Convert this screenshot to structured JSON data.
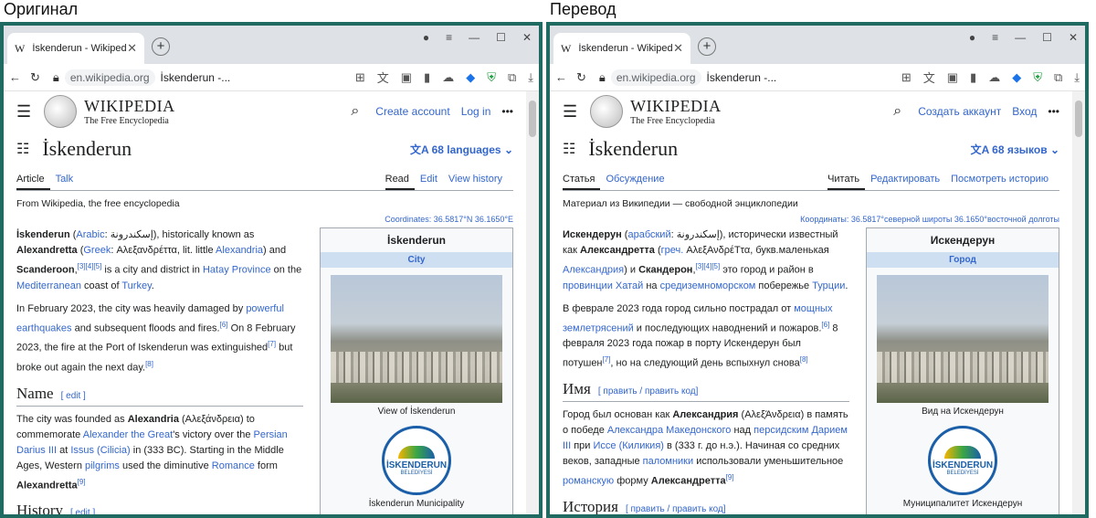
{
  "captions": {
    "left": "Оригинал",
    "right": "Перевод"
  },
  "left": {
    "tab_title": "İskenderun - Wikipedia",
    "favicon": "W",
    "url_domain": "en.wikipedia.org",
    "url_rest": "İskenderun -...",
    "wm_title": "WIKIPEDIA",
    "wm_tag": "The Free Encyclopedia",
    "create_account": "Create account",
    "log_in": "Log in",
    "page_title": "İskenderun",
    "languages": "68 languages",
    "tab_article": "Article",
    "tab_talk": "Talk",
    "tab_read": "Read",
    "tab_edit": "Edit",
    "tab_history": "View history",
    "from": "From Wikipedia, the free encyclopedia",
    "coords": "Coordinates: 36.5817°N 36.1650°E",
    "p1": {
      "a": "İskenderun",
      "b": " (",
      "c": "Arabic",
      "d": ": إسكندرونة), historically known as ",
      "e": "Alexandretta",
      "f": " (",
      "g": "Greek",
      "h": ": Αλεξανδρέττα, lit. little ",
      "i": "Alexandria",
      "j": ") and ",
      "k": "Scanderoon",
      "l": ",",
      "m": "[3][4][5]",
      "n": " is a city and district in ",
      "o": "Hatay Province",
      "p": " on the ",
      "q": "Mediterranean",
      "r": " coast of ",
      "s": "Turkey",
      "t": "."
    },
    "p2": {
      "a": "In February 2023, the city was heavily damaged by ",
      "b": "powerful earthquakes",
      "c": " and subsequent floods and fires.",
      "d": "[6]",
      "e": " On 8 February 2023, the fire at the Port of Iskenderun was extinguished",
      "f": "[7]",
      "g": " but broke out again the next day.",
      "h": "[8]"
    },
    "h_name": "Name",
    "edit": "[ edit ]",
    "p3": {
      "a": "The city was founded as ",
      "b": "Alexandria",
      "c": " (Αλεξάνδρεια) to commemorate ",
      "d": "Alexander the Great",
      "e": "'s victory over the ",
      "f": "Persian Darius III",
      "g": " at ",
      "h": "Issus (Cilicia)",
      "i": " in (333 BC). Starting in the Middle Ages, Western ",
      "j": "pilgrims",
      "k": " used the diminutive ",
      "l": "Romance",
      "m": " form ",
      "n": "Alexandretta",
      "o": "[9]"
    },
    "h_history": "History",
    "ib_title": "İskenderun",
    "ib_sub": "City",
    "ib_cap1": "View of İskenderun",
    "ib_cap2": "İskenderun Municipality",
    "logo_word": "İSKENDERUN",
    "logo_sub": "BELEDİYESİ"
  },
  "right": {
    "tab_title": "İskenderun - Wikipedia",
    "favicon": "W",
    "url_domain": "en.wikipedia.org",
    "url_rest": "İskenderun -...",
    "wm_title": "WIKIPEDIA",
    "wm_tag": "The Free Encyclopedia",
    "create_account": "Создать аккаунт",
    "log_in": "Вход",
    "page_title": "İskenderun",
    "languages": "68 языков",
    "tab_article": "Статья",
    "tab_talk": "Обсуждение",
    "tab_read": "Читать",
    "tab_edit": "Редактировать",
    "tab_history": "Посмотреть историю",
    "from": "Материал из Википедии — свободной энциклопедии",
    "coords": "Координаты: 36.5817°северной широты 36.1650°восточной долготы",
    "p1": {
      "a": "Искендерун",
      "b": " (",
      "c": "арабский",
      "d": ": إسكندرونة), исторически известный как ",
      "e": "Александретта",
      "f": " (",
      "g": "греч.",
      "h": " ΑλεξΑνδρέΤτα, букв.маленькая ",
      "i": "Александрия",
      "j": ") и ",
      "k": "Скандерон",
      "l": ",",
      "m": "[3][4][5]",
      "n": " это город и район в ",
      "o": "провинции Хатай",
      "p": " на ",
      "q": "средиземноморском",
      "r": " побережье ",
      "s": "Турции",
      "t": "."
    },
    "p2": {
      "a": "В феврале 2023 года город сильно пострадал от ",
      "b": "мощных землетрясений",
      "c": " и последующих наводнений и пожаров.",
      "d": "[6]",
      "e": " 8 февраля 2023 года пожар в порту Искендерун был потушен",
      "f": "[7]",
      "g": ", но на следующий день вспыхнул снова",
      "h": "[8]"
    },
    "h_name": "Имя",
    "edit": "[ править / править код]",
    "p3": {
      "a": "Город был основан как ",
      "b": "Александрия",
      "c": " (ΑλεξΆνδρεια) в память о победе ",
      "d": "Александра Македонского",
      "e": " над ",
      "f": "персидским Дарием III",
      "g": " при ",
      "h": "Иссе (Киликия)",
      "i": " в (333 г. до н.э.). Начиная со средних веков, западные ",
      "j": "паломники",
      "k": " использовали уменьшительное ",
      "l": "романскую",
      "m": " форму ",
      "n": "Александретта",
      "o": "[9]"
    },
    "h_history": "История",
    "ib_title": "Искендерун",
    "ib_sub": "Город",
    "ib_cap1": "Вид на Искендерун",
    "ib_cap2": "Муниципалитет Искендерун",
    "logo_word": "İSKENDERUN",
    "logo_sub": "BELEDİYESİ"
  },
  "icons": {
    "back": "back-arrow-icon",
    "reload": "reload-icon",
    "lock": "lock-icon",
    "search": "search-icon",
    "menu": "hamburger-icon",
    "toc": "toc-icon",
    "more": "more-icon",
    "translate": "translate-icon"
  }
}
